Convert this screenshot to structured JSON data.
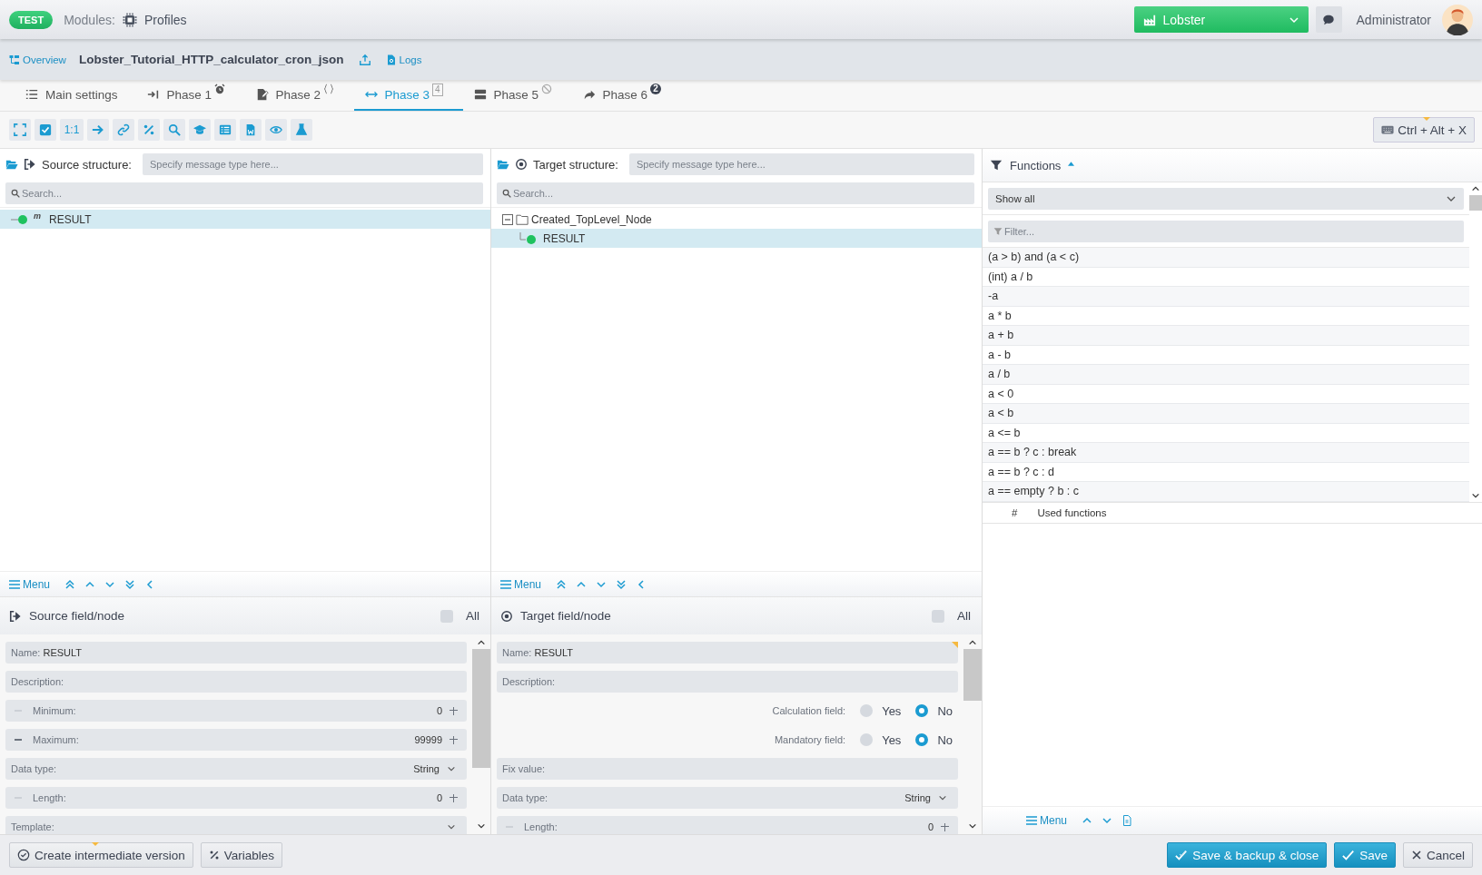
{
  "header": {
    "env_badge": "TEST",
    "modules_label": "Modules:",
    "module": "Profiles",
    "company": "Lobster",
    "user": "Administrator"
  },
  "subbar": {
    "overview_link": "Overview",
    "title": "Lobster_Tutorial_HTTP_calculator_cron_json",
    "logs_link": "Logs"
  },
  "tabs": [
    {
      "label": "Main settings",
      "selected": false
    },
    {
      "label": "Phase 1",
      "selected": false
    },
    {
      "label": "Phase 2",
      "selected": false
    },
    {
      "label": "Phase 3",
      "selected": true,
      "badge": {
        "kind": "box",
        "text": "4"
      }
    },
    {
      "label": "Phase 5",
      "selected": false
    },
    {
      "label": "Phase 6",
      "selected": false,
      "badge": {
        "kind": "circle",
        "text": "2"
      }
    }
  ],
  "toolbar": {
    "ratio_button": "1:1",
    "shortcut_button": "Ctrl + Alt + X"
  },
  "panels": [
    {
      "kind": "source",
      "label": "Source structure:",
      "type_placeholder": "Specify message type here...",
      "search_placeholder": "Search...",
      "tree": [
        {
          "kind": "field",
          "name": "RESULT",
          "marker": "m",
          "selected": true
        }
      ],
      "menu": "Menu",
      "field_title": "Source field/node",
      "all_label": "All",
      "all_checked": false,
      "fields": [
        {
          "kind": "text",
          "label": "Name:",
          "value": "RESULT"
        },
        {
          "kind": "text",
          "label": "Description:"
        },
        {
          "kind": "stepper",
          "label": "Minimum:",
          "value": "0",
          "minus_disabled": true
        },
        {
          "kind": "stepper",
          "label": "Maximum:",
          "value": "99999",
          "minus_disabled": false
        },
        {
          "kind": "select",
          "label": "Data type:",
          "value": "String"
        },
        {
          "kind": "stepper",
          "label": "Length:",
          "value": "0",
          "minus_disabled": true
        },
        {
          "kind": "select",
          "label": "Template:"
        }
      ]
    },
    {
      "kind": "target",
      "label": "Target structure:",
      "type_placeholder": "Specify message type here...",
      "search_placeholder": "Search...",
      "tree": [
        {
          "kind": "folder",
          "name": "Created_TopLevel_Node",
          "selected": false,
          "expanded": true,
          "children": [
            {
              "kind": "field",
              "name": "RESULT",
              "selected": true
            }
          ]
        }
      ],
      "menu": "Menu",
      "field_title": "Target field/node",
      "all_label": "All",
      "all_checked": false,
      "fields": [
        {
          "kind": "text",
          "label": "Name:",
          "value": "RESULT",
          "marked": true
        },
        {
          "kind": "text",
          "label": "Description:"
        },
        {
          "kind": "radio",
          "label": "Calculation field:",
          "options": [
            {
              "label": "Yes",
              "selected": false
            },
            {
              "label": "No",
              "selected": true
            }
          ]
        },
        {
          "kind": "radio",
          "label": "Mandatory field:",
          "options": [
            {
              "label": "Yes",
              "selected": false
            },
            {
              "label": "No",
              "selected": true
            }
          ]
        },
        {
          "kind": "text",
          "label": "Fix value:"
        },
        {
          "kind": "select",
          "label": "Data type:",
          "value": "String"
        },
        {
          "kind": "stepper",
          "label": "Length:",
          "value": "0",
          "minus_disabled": true
        }
      ]
    }
  ],
  "functions": {
    "title": "Functions",
    "filter_select": "Show all",
    "filter_placeholder": "Filter...",
    "items": [
      "(a > b) and (a < c)",
      "(int) a / b",
      "-a",
      "a * b",
      "a + b",
      "a - b",
      "a / b",
      "a < 0",
      "a < b",
      "a <= b",
      "a == b ? c : break",
      "a == b ? c : d",
      "a == empty ? b : c"
    ],
    "used_hash": "#",
    "used_header": "Used functions",
    "menu": "Menu"
  },
  "footer": {
    "create_version": "Create intermediate version",
    "variables": "Variables",
    "save_close": "Save & backup & close",
    "save": "Save",
    "cancel": "Cancel"
  }
}
